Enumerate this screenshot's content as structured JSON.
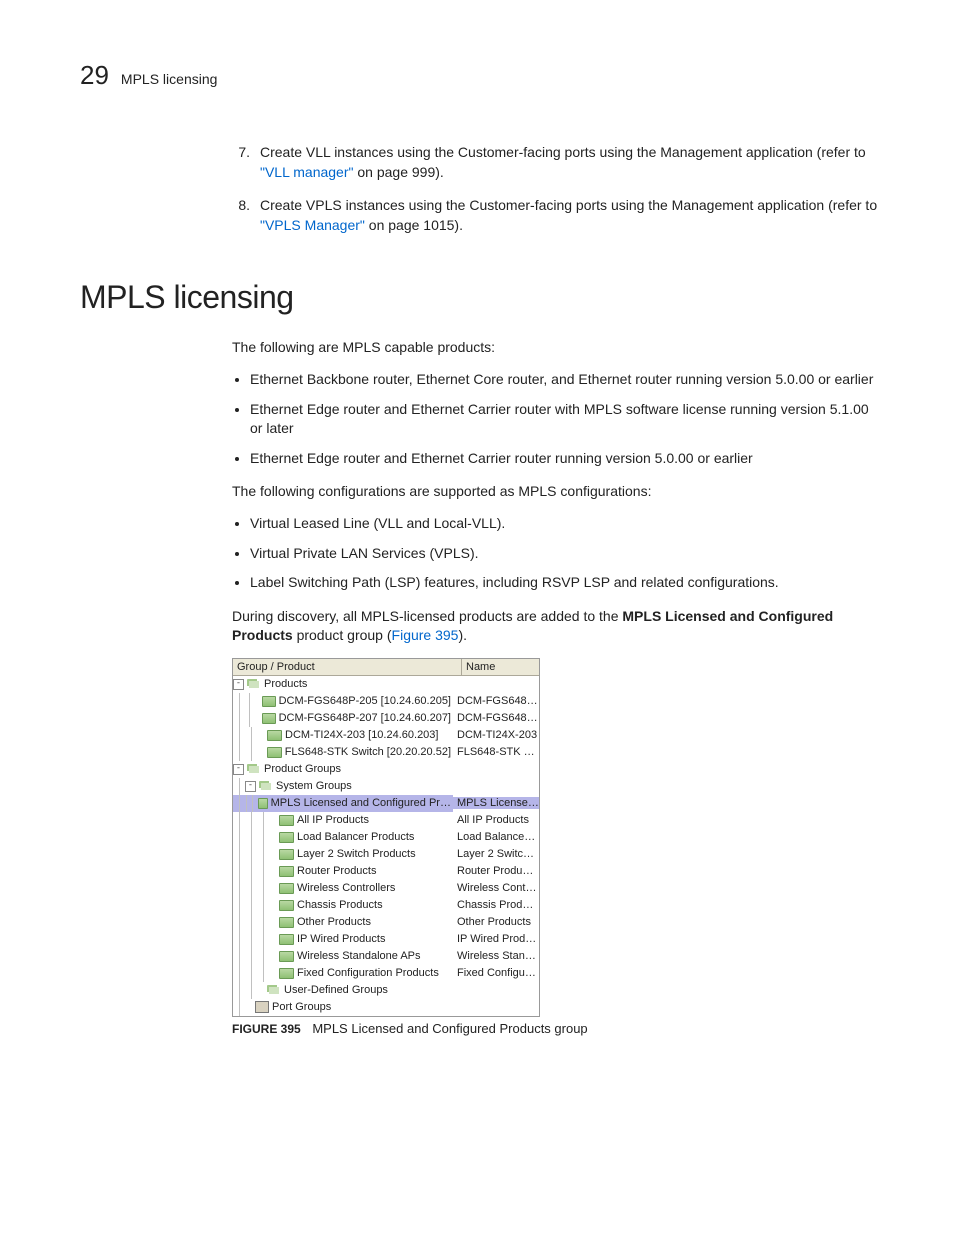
{
  "header": {
    "page_number": "29",
    "running_title": "MPLS licensing"
  },
  "steps": [
    {
      "n": "7.",
      "pre": "Create VLL instances using the Customer-facing ports using the Management application (refer to ",
      "link": "\"VLL manager\"",
      "post": " on page 999)."
    },
    {
      "n": "8.",
      "pre": "Create VPLS instances using the Customer-facing ports using the Management application (refer to ",
      "link": "\"VPLS Manager\"",
      "post": " on page 1015)."
    }
  ],
  "section_title": "MPLS licensing",
  "intro1": "The following are MPLS capable products:",
  "bullets1": [
    "Ethernet Backbone router, Ethernet Core router, and Ethernet router  running version 5.0.00 or earlier",
    "Ethernet Edge router and Ethernet Carrier router with MPLS software license running version 5.1.00 or later",
    "Ethernet Edge router and Ethernet Carrier router running version 5.0.00 or earlier"
  ],
  "intro2": "The following configurations are supported as MPLS configurations:",
  "bullets2": [
    "Virtual Leased Line (VLL and Local-VLL).",
    "Virtual Private LAN Services (VPLS).",
    "Label Switching Path (LSP) features, including RSVP LSP and related configurations."
  ],
  "para_end_pre": "During discovery, all MPLS-licensed products are added to the ",
  "para_end_bold": "MPLS Licensed and Configured Products",
  "para_end_mid": " product group (",
  "para_end_link": "Figure 395",
  "para_end_post": ").",
  "tree": {
    "header_col1": "Group / Product",
    "header_col2": "Name",
    "rows": [
      {
        "depth": 0,
        "toggle": "-",
        "icon": "stack",
        "label": "Products",
        "name": "",
        "sel": false
      },
      {
        "depth": 2,
        "toggle": "",
        "icon": "leaf",
        "label": "DCM-FGS648P-205 [10.24.60.205]",
        "name": "DCM-FGS648…",
        "sel": false
      },
      {
        "depth": 2,
        "toggle": "",
        "icon": "leaf",
        "label": "DCM-FGS648P-207 [10.24.60.207]",
        "name": "DCM-FGS648…",
        "sel": false
      },
      {
        "depth": 2,
        "toggle": "",
        "icon": "leaf",
        "label": "DCM-TI24X-203 [10.24.60.203]",
        "name": "DCM-TI24X-203",
        "sel": false
      },
      {
        "depth": 2,
        "toggle": "",
        "icon": "leaf",
        "label": "FLS648-STK Switch [20.20.20.52]",
        "name": "FLS648-STK …",
        "sel": false
      },
      {
        "depth": 0,
        "toggle": "-",
        "icon": "stack",
        "label": "Product Groups",
        "name": "",
        "sel": false
      },
      {
        "depth": 1,
        "toggle": "-",
        "icon": "stack",
        "label": "System Groups",
        "name": "",
        "sel": false
      },
      {
        "depth": 3,
        "toggle": "",
        "icon": "leaf",
        "label": "MPLS Licensed and Configured Pr…",
        "name": "MPLS License…",
        "sel": true
      },
      {
        "depth": 3,
        "toggle": "",
        "icon": "leaf",
        "label": "All IP Products",
        "name": "All IP Products",
        "sel": false
      },
      {
        "depth": 3,
        "toggle": "",
        "icon": "leaf",
        "label": "Load Balancer Products",
        "name": "Load Balance…",
        "sel": false
      },
      {
        "depth": 3,
        "toggle": "",
        "icon": "leaf",
        "label": "Layer 2 Switch Products",
        "name": "Layer 2 Switc…",
        "sel": false
      },
      {
        "depth": 3,
        "toggle": "",
        "icon": "leaf",
        "label": "Router Products",
        "name": "Router Produ…",
        "sel": false
      },
      {
        "depth": 3,
        "toggle": "",
        "icon": "leaf",
        "label": "Wireless Controllers",
        "name": "Wireless Cont…",
        "sel": false
      },
      {
        "depth": 3,
        "toggle": "",
        "icon": "leaf",
        "label": "Chassis Products",
        "name": "Chassis Prod…",
        "sel": false
      },
      {
        "depth": 3,
        "toggle": "",
        "icon": "leaf",
        "label": "Other Products",
        "name": "Other Products",
        "sel": false
      },
      {
        "depth": 3,
        "toggle": "",
        "icon": "leaf",
        "label": "IP Wired Products",
        "name": "IP Wired Prod…",
        "sel": false
      },
      {
        "depth": 3,
        "toggle": "",
        "icon": "leaf",
        "label": "Wireless Standalone APs",
        "name": "Wireless Stan…",
        "sel": false
      },
      {
        "depth": 3,
        "toggle": "",
        "icon": "leaf",
        "label": "Fixed Configuration Products",
        "name": "Fixed Configu…",
        "sel": false
      },
      {
        "depth": 2,
        "toggle": "",
        "icon": "stack",
        "label": "User-Defined Groups",
        "name": "",
        "sel": false
      },
      {
        "depth": 1,
        "toggle": "",
        "icon": "port",
        "label": "Port Groups",
        "name": "",
        "sel": false
      }
    ]
  },
  "figure": {
    "label": "FIGURE 395",
    "caption": "MPLS Licensed and Configured Products group"
  }
}
